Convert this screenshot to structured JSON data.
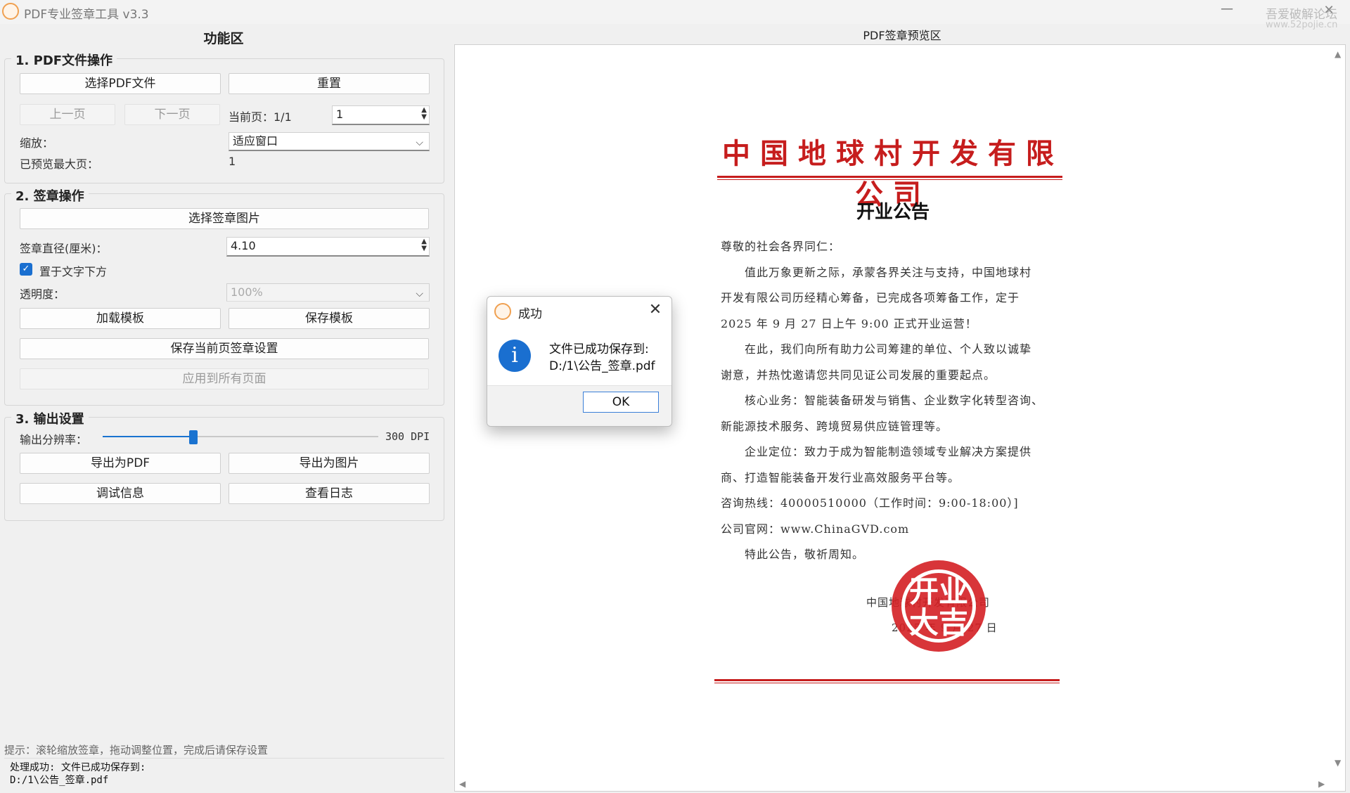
{
  "window": {
    "title": "PDF专业签章工具 v3.3",
    "minimize_glyph": "—",
    "watermark_line1": "吾爱破解论坛",
    "watermark_line2": "www.52pojie.cn",
    "close_glyph": "✕",
    "app_icon": "seal-logo-icon"
  },
  "left_panel": {
    "title": "功能区",
    "group1": {
      "title": "1. PDF文件操作",
      "select_pdf": "选择PDF文件",
      "reset": "重置",
      "prev_page": "上一页",
      "next_page": "下一页",
      "current_page_label": "当前页：1/1",
      "page_input_value": "1",
      "zoom_label": "缩放：",
      "zoom_value": "适应窗口",
      "max_previewed_label": "已预览最大页：",
      "max_previewed_value": "1"
    },
    "group2": {
      "title": "2. 签章操作",
      "select_seal": "选择签章图片",
      "diameter_label": "签章直径(厘米)：",
      "diameter_value": "4.10",
      "below_text_checkbox": "置于文字下方",
      "below_text_checked": true,
      "opacity_label": "透明度：",
      "opacity_value": "100%",
      "load_template": "加载模板",
      "save_template": "保存模板",
      "save_page_settings": "保存当前页签章设置",
      "apply_all": "应用到所有页面"
    },
    "group3": {
      "title": "3. 输出设置",
      "resolution_label": "输出分辨率：",
      "resolution_value": "300 DPI",
      "resolution_slider_fraction": 0.33,
      "export_pdf": "导出为PDF",
      "export_image": "导出为图片",
      "debug_info": "调试信息",
      "view_log": "查看日志"
    },
    "hint": "提示：滚轮缩放签章，拖动调整位置，完成后请保存设置",
    "status": "处理成功: 文件已成功保存到:\nD:/1\\公告_签章.pdf"
  },
  "preview": {
    "title": "PDF签章预览区",
    "document": {
      "company_header": "中国地球村开发有限公司",
      "heading": "开业公告",
      "paragraphs": [
        "尊敬的社会各界同仁：",
        "　　值此万象更新之际，承蒙各界关注与支持，中国地球村",
        "开发有限公司历经精心筹备，已完成各项筹备工作，定于",
        "2025 年 9 月 27 日上午 9:00 正式开业运营！",
        "　　在此，我们向所有助力公司筹建的单位、个人致以诚挚",
        "谢意，并热忱邀请您共同见证公司发展的重要起点。",
        "　　核心业务：智能装备研发与销售、企业数字化转型咨询、",
        "新能源技术服务、跨境贸易供应链管理等。",
        "　　企业定位：致力于成为智能制造领域专业解决方案提供",
        "商、打造智能装备开发行业高效服务平台等。",
        "咨询热线：40000510000（工作时间：9:00-18:00）]",
        "公司官网：www.ChinaGVD.com",
        "　　特此公告，敬祈周知。"
      ],
      "signature_company": "中国地球村开发有限公司",
      "signature_date": "2025 年 9 月 27 日",
      "seal_text": "开业大吉"
    }
  },
  "dialog": {
    "title": "成功",
    "message_line1": "文件已成功保存到:",
    "message_line2": "D:/1\\公告_签章.pdf",
    "ok": "OK",
    "close_glyph": "✕",
    "info_glyph": "i"
  },
  "colors": {
    "accent": "#1a6fd0",
    "doc_red": "#c61d1d",
    "seal_red": "#d41f24"
  }
}
